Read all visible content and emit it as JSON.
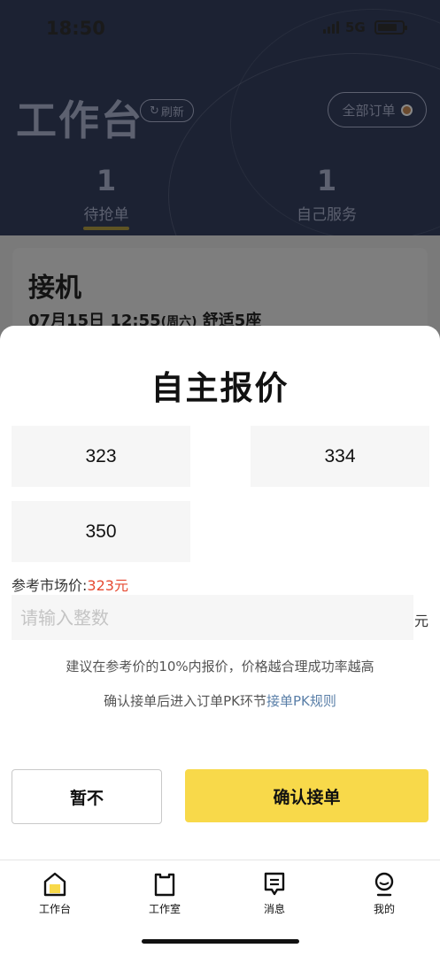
{
  "status_bar": {
    "time": "18:50",
    "network": "5G",
    "battery_level": 0.8
  },
  "header": {
    "title": "工作台",
    "refresh_label": "刷新",
    "all_orders_label": "全部订单",
    "stats": [
      {
        "count": "1",
        "label": "待抢单"
      },
      {
        "count": "1",
        "label": "自己服务"
      }
    ]
  },
  "order": {
    "type": "接机",
    "datetime": "07月15日 12:55",
    "weekday": "(周六)",
    "car_class": "舒适5座"
  },
  "sheet": {
    "title": "自主报价",
    "price_options": [
      "323",
      "334",
      "350"
    ],
    "reference_label": "参考市场价:",
    "reference_value": "323元",
    "input_placeholder": "请输入整数",
    "unit": "元",
    "tip_line1": "建议在参考价的10%内报价，价格越合理成功率越高",
    "tip_line2_prefix": "确认接单后进入订单PK环节",
    "tip_line2_link": "接单PK规则",
    "cancel_label": "暂不",
    "confirm_label": "确认接单"
  },
  "tabbar": {
    "items": [
      {
        "label": "工作台",
        "icon": "home-icon"
      },
      {
        "label": "工作室",
        "icon": "studio-icon"
      },
      {
        "label": "消息",
        "icon": "message-icon"
      },
      {
        "label": "我的",
        "icon": "profile-icon"
      }
    ]
  },
  "colors": {
    "accent": "#f8d94a",
    "header_bg": "#1c2233",
    "price_highlight": "#e64a32",
    "link": "#5a7fa8"
  }
}
